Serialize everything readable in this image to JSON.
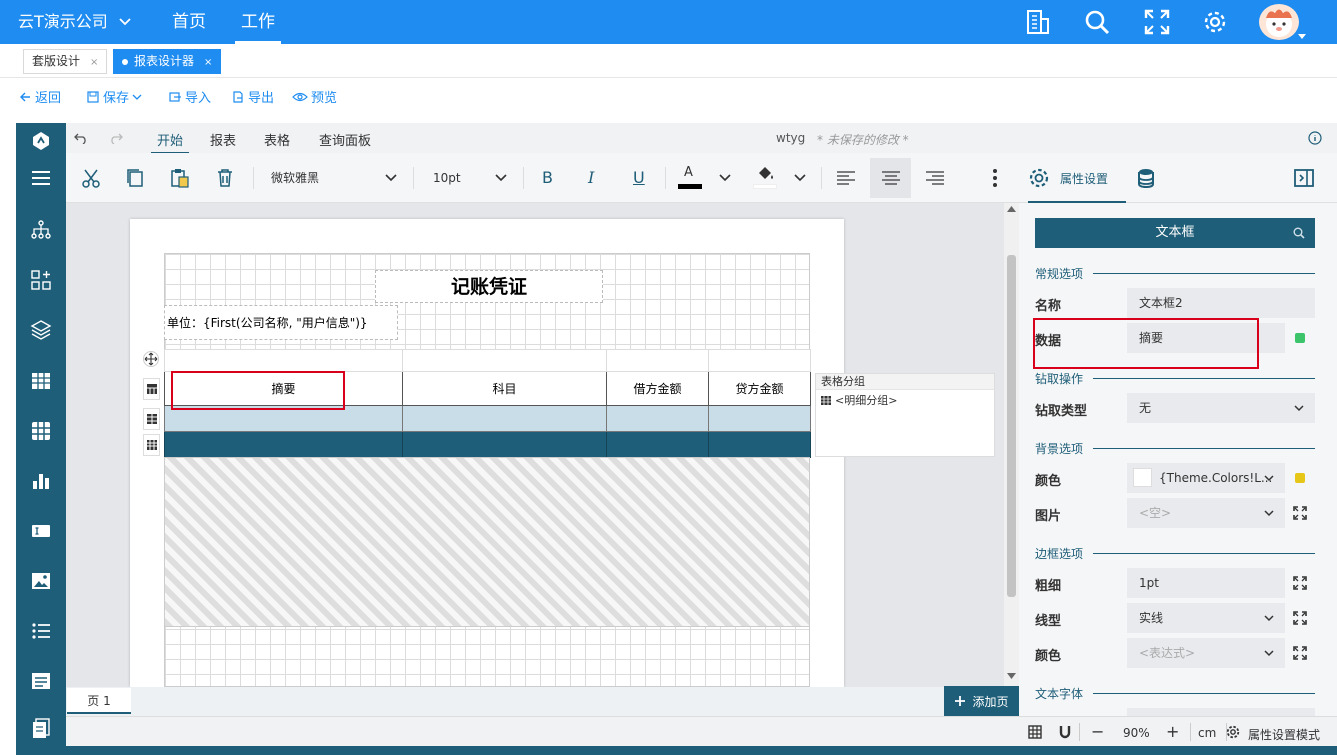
{
  "topbar": {
    "company": "云T演示公司",
    "nav": [
      "首页",
      "工作"
    ],
    "active_nav": "工作",
    "accent": "#1e8cf0"
  },
  "tabs": [
    {
      "label": "套版设计",
      "close": "×"
    },
    {
      "label": "报表设计器",
      "close": "×"
    }
  ],
  "actions": {
    "back": "返回",
    "save": "保存",
    "import": "导入",
    "export": "导出",
    "preview": "预览"
  },
  "ribbon": {
    "tabs": [
      "开始",
      "报表",
      "表格",
      "查询面板"
    ],
    "report_name": "wtyg",
    "unsaved": "* 未保存的修改 *",
    "font_family": "微软雅黑",
    "font_size": "10pt",
    "bold": "B",
    "italic": "I",
    "underline": "U",
    "font_color_letter": "A"
  },
  "canvas": {
    "title": "记账凭证",
    "unit_expr": "单位：{First(公司名称, \"用户信息\")}",
    "table_headers": [
      "摘要",
      "科目",
      "借方金额",
      "贷方金额"
    ],
    "group_panel_title": "表格分组",
    "group_item": "<明细分组>",
    "brand_color": "#1f5e78"
  },
  "pages": {
    "tab": "页 1",
    "add": "添加页"
  },
  "status": {
    "zoom": "90%",
    "unit": "cm",
    "mode": "属性设置模式",
    "minus": "−",
    "plus": "+"
  },
  "panel": {
    "tab": "属性设置",
    "component": "文本框",
    "sections": {
      "general": "常规选项",
      "drill": "钻取操作",
      "background": "背景选项",
      "border": "边框选项",
      "font": "文本字体"
    },
    "labels": {
      "name": "名称",
      "data": "数据",
      "drill_type": "钻取类型",
      "color": "颜色",
      "image": "图片",
      "width": "粗细",
      "style": "线型",
      "border_color": "颜色"
    },
    "values": {
      "name": "文本框2",
      "data": "摘要",
      "drill_type": "无",
      "bg_color": "{Theme.Colors!L...",
      "image": "<空>",
      "width": "1pt",
      "style": "实线",
      "border_color": "<表达式>"
    },
    "indicator_green": "#3cc46a",
    "indicator_yellow": "#e6c619"
  }
}
